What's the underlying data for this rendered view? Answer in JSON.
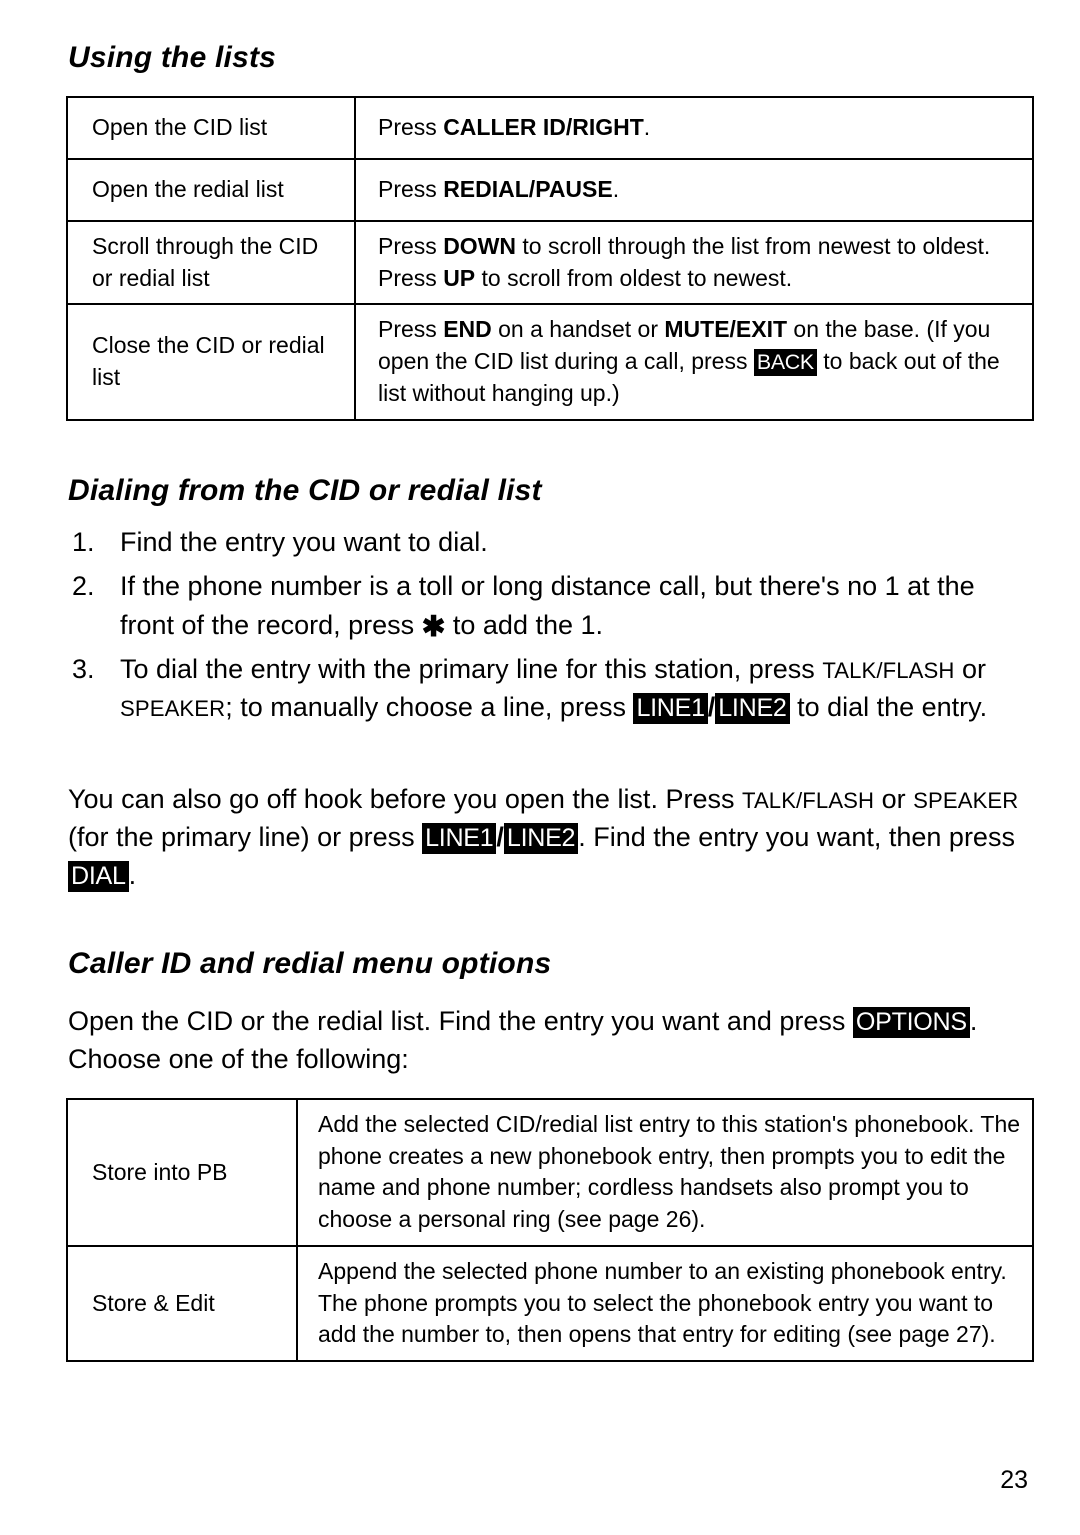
{
  "page": {
    "number": "23"
  },
  "sections": {
    "using_the_lists": {
      "heading": "Using the lists",
      "table": {
        "rows": [
          {
            "label": "Open the CID list",
            "desc_prefix": "Press ",
            "desc_key": "CALLER ID/RIGHT",
            "desc_suffix": "."
          },
          {
            "label": "Open the redial list",
            "desc_prefix": "Press ",
            "desc_key": "REDIAL/PAUSE",
            "desc_suffix": "."
          },
          {
            "label": "Scroll through the CID or redial list",
            "p1": "Press ",
            "k1": "DOWN",
            "p2": " to scroll through the list from newest to oldest. Press ",
            "k2": "UP",
            "p3": " to scroll from oldest to newest."
          },
          {
            "label": "Close the CID or redial list",
            "p1": "Press ",
            "k1": "END",
            "p2": " on a handset or ",
            "k2": "MUTE/EXIT",
            "p3": " on the base. (If you open the CID list during a call, press ",
            "keycap": "BACK",
            "p4": " to back out of the list without hanging up.)"
          }
        ]
      }
    },
    "dialing": {
      "heading": "Dialing from the CID or redial list",
      "steps": [
        {
          "num": "1.",
          "text": "Find the entry you want to dial."
        },
        {
          "num": "2.",
          "p1": "If the phone number is a toll or long distance call, but there's no 1 at the front of the record, press ",
          "star": "✱",
          "p2": " to add the 1."
        },
        {
          "num": "3.",
          "p1": "To dial the entry with the primary line for this station, press ",
          "sc1": "TALK/FLASH",
          "p2": " or ",
          "sc2": "SPEAKER",
          "p3": "; to manually choose a line, press ",
          "keycap1": "LINE1",
          "sep": "/",
          "keycap2": "LINE2",
          "p4": " to dial the entry."
        }
      ],
      "paragraph": {
        "p1": "You can also go off hook before you open the list. Press ",
        "sc1": "TALK/FLASH",
        "p2": " or ",
        "sc2": "SPEAKER",
        "p3": " (for the primary line) or press ",
        "keycap1": "LINE1",
        "sep": "/",
        "keycap2": "LINE2",
        "p4": ". Find the entry you want, then press ",
        "keycap3": "DIAL",
        "p5": "."
      }
    },
    "menu_options": {
      "heading": "Caller ID and redial menu options",
      "intro": {
        "p1": "Open the CID or the redial list. Find the entry you want and press ",
        "keycap": "OPTIONS",
        "p2": ". Choose one of the following:"
      },
      "table": {
        "rows": [
          {
            "label": "Store into PB",
            "desc": "Add the selected CID/redial list entry to this station's phonebook. The phone creates a new phonebook entry, then prompts you to edit the name and phone number; cordless handsets also prompt you to choose a personal ring (see page 26)."
          },
          {
            "label": "Store & Edit",
            "desc": "Append the selected phone number to an existing phonebook entry. The phone prompts you to select the phonebook entry you want to add the number to, then opens that entry for editing (see page 27)."
          }
        ]
      }
    }
  },
  "colors": {
    "text": "#000000",
    "background": "#ffffff",
    "keycap_background": "#000000",
    "keycap_text": "#ffffff",
    "table_border": "#000000"
  }
}
